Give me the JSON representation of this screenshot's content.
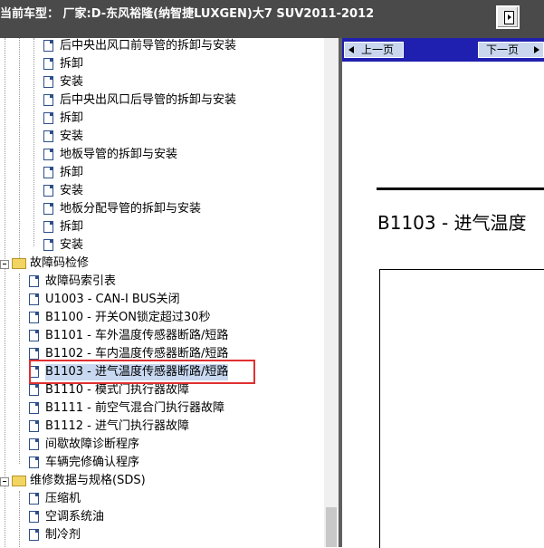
{
  "header": {
    "vehicle_label": "当前车型：  厂家:D-东风裕隆(纳智捷LUXGEN)大7 SUV2011-2012"
  },
  "tree": {
    "items": [
      {
        "label": "后中央出风口前导管的拆卸与安装"
      },
      {
        "label": "拆卸"
      },
      {
        "label": "安装"
      },
      {
        "label": "后中央出风口后导管的拆卸与安装"
      },
      {
        "label": "拆卸"
      },
      {
        "label": "安装"
      },
      {
        "label": "地板导管的拆卸与安装"
      },
      {
        "label": "拆卸"
      },
      {
        "label": "安装"
      },
      {
        "label": "地板分配导管的拆卸与安装"
      },
      {
        "label": "拆卸"
      },
      {
        "label": "安装"
      }
    ],
    "folder1": "故障码检修",
    "codes": [
      {
        "label": "故障码索引表"
      },
      {
        "label": "U1003 - CAN-I BUS关闭"
      },
      {
        "label": "B1100 - 开关ON锁定超过30秒"
      },
      {
        "label": "B1101 - 车外温度传感器断路/短路"
      },
      {
        "label": "B1102 - 车内温度传感器断路/短路"
      },
      {
        "label": "B1103 - 进气温度传感器断路/短路"
      },
      {
        "label": "B1110 - 模式门执行器故障"
      },
      {
        "label": "B1111 - 前空气混合门执行器故障"
      },
      {
        "label": "B1112 - 进气门执行器故障"
      },
      {
        "label": "间歇故障诊断程序"
      },
      {
        "label": "车辆完修确认程序"
      }
    ],
    "folder2": "维修数据与规格(SDS)",
    "sds": [
      {
        "label": "压缩机"
      },
      {
        "label": "空调系统油"
      },
      {
        "label": "制冷剂"
      }
    ]
  },
  "viewer": {
    "prev_label": "上一页",
    "next_label": "下一页",
    "doc_title": "B1103 - 进气温度"
  },
  "colors": {
    "highlight": "#e03030",
    "topbar": "#4a4a4a",
    "navbar": "#1f1fb0"
  }
}
